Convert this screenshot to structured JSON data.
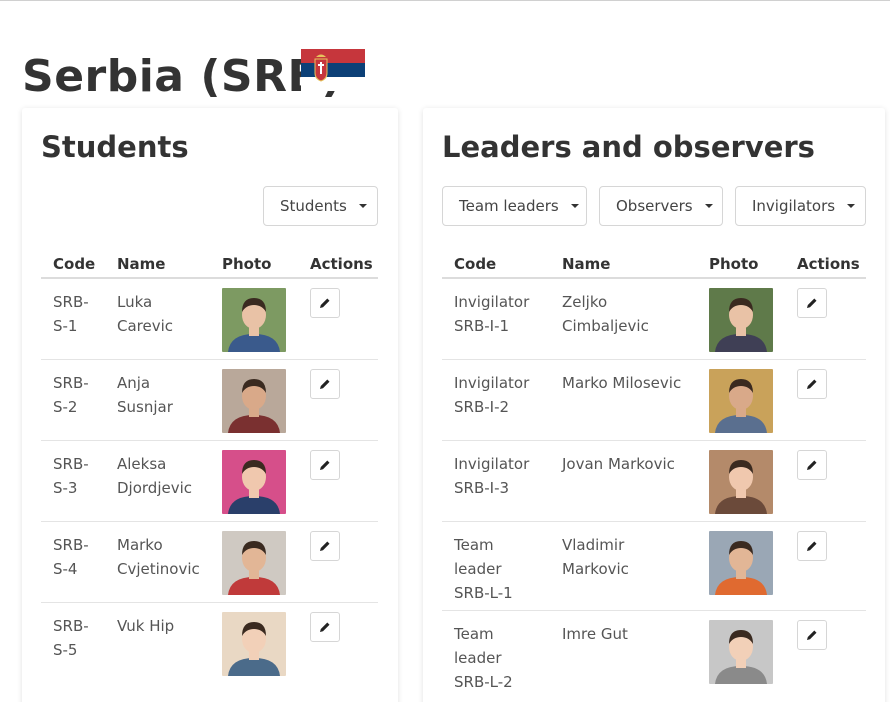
{
  "page": {
    "title": "Serbia (SRB)"
  },
  "students": {
    "heading": "Students",
    "dropdown": "Students",
    "columns": {
      "code": "Code",
      "name": "Name",
      "photo": "Photo",
      "actions": "Actions"
    },
    "rows": [
      {
        "code": [
          "SRB-",
          "S-1"
        ],
        "name": [
          "Luka",
          "Carevic"
        ]
      },
      {
        "code": [
          "SRB-",
          "S-2"
        ],
        "name": [
          "Anja",
          "Susnjar"
        ]
      },
      {
        "code": [
          "SRB-",
          "S-3"
        ],
        "name": [
          "Aleksa",
          "Djordjevic"
        ]
      },
      {
        "code": [
          "SRB-",
          "S-4"
        ],
        "name": [
          "Marko",
          "Cvjetinovic"
        ]
      },
      {
        "code": [
          "SRB-",
          "S-5"
        ],
        "name": [
          "Vuk Hip"
        ]
      }
    ]
  },
  "leaders": {
    "heading": "Leaders and observers",
    "dropdowns": [
      "Team leaders",
      "Observers",
      "Invigilators"
    ],
    "columns": {
      "code": "Code",
      "name": "Name",
      "photo": "Photo",
      "actions": "Actions"
    },
    "rows": [
      {
        "code": [
          "Invigilator",
          "SRB-I-1"
        ],
        "name": [
          "Zeljko",
          "Cimbaljevic"
        ]
      },
      {
        "code": [
          "Invigilator",
          "SRB-I-2"
        ],
        "name": [
          "Marko Milosevic"
        ]
      },
      {
        "code": [
          "Invigilator",
          "SRB-I-3"
        ],
        "name": [
          "Jovan Markovic"
        ]
      },
      {
        "code": [
          "Team",
          "leader",
          "SRB-L-1"
        ],
        "name": [
          "Vladimir",
          "Markovic"
        ]
      },
      {
        "code": [
          "Team",
          "leader",
          "SRB-L-2"
        ],
        "name": [
          "Imre Gut"
        ]
      }
    ]
  },
  "icons": {
    "caret": "caret-down-icon",
    "edit": "pencil-icon",
    "photo": "person-photo",
    "flag": "serbia-flag"
  },
  "colors": {
    "flag_red": "#c6363c",
    "flag_blue": "#0c4077",
    "flag_white": "#ffffff"
  }
}
